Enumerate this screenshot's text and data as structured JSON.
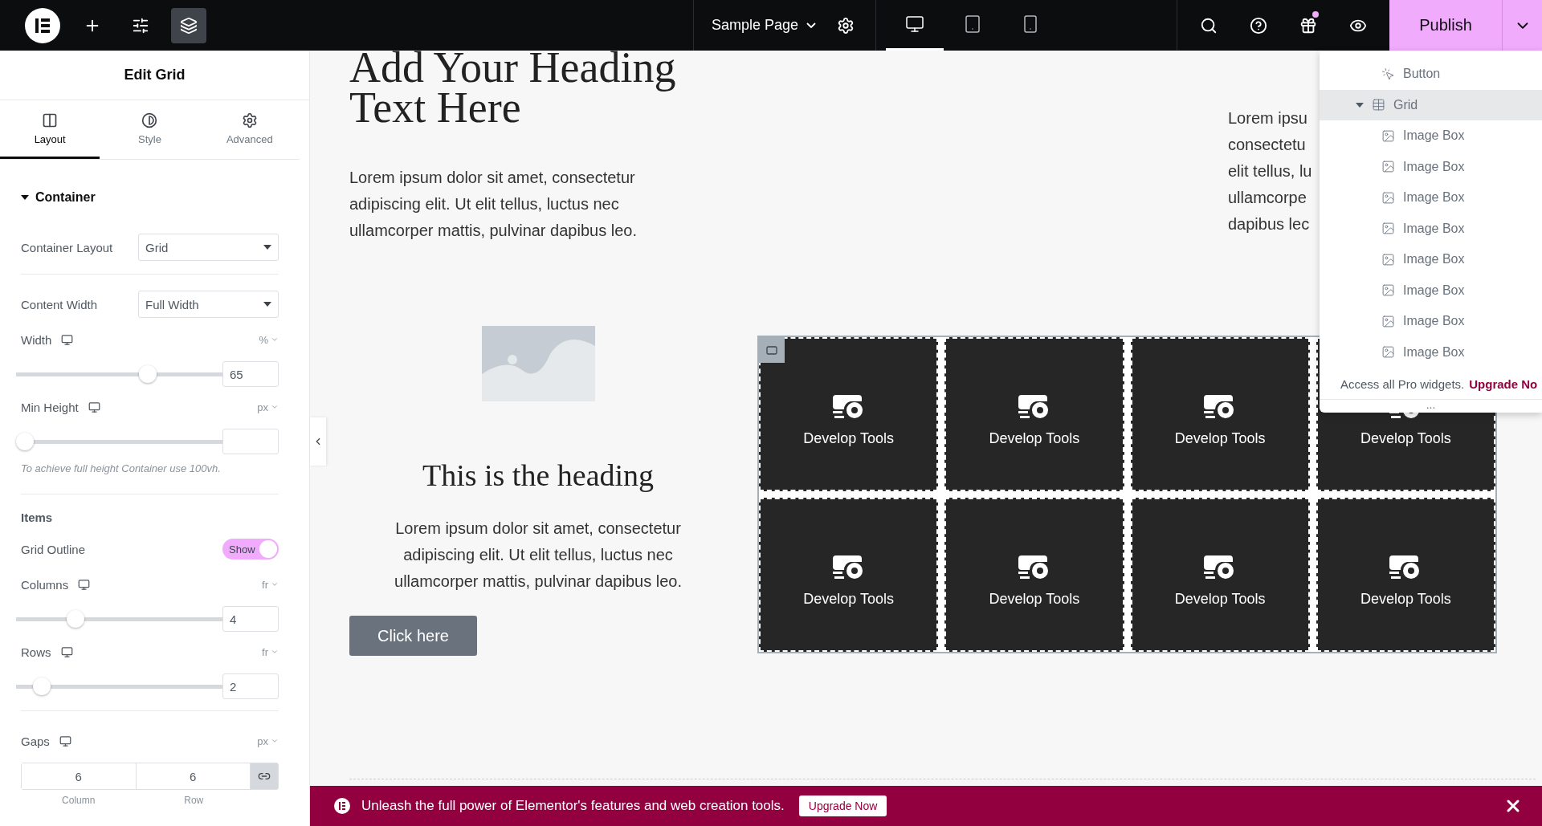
{
  "topbar": {
    "tools": [
      {
        "kind": "add",
        "selected": false
      },
      {
        "kind": "sliders",
        "selected": false
      },
      {
        "kind": "layers",
        "selected": true
      }
    ],
    "page_title": "Sample Page",
    "devices": [
      {
        "kind": "desktop",
        "selected": true
      },
      {
        "kind": "tablet",
        "selected": false
      },
      {
        "kind": "mobile",
        "selected": false
      }
    ],
    "right_tools": [
      {
        "kind": "search",
        "badge": false
      },
      {
        "kind": "help",
        "badge": false
      },
      {
        "kind": "gift",
        "badge": true
      },
      {
        "kind": "preview",
        "badge": false
      }
    ],
    "publish": "Publish"
  },
  "panel": {
    "title": "Edit Grid",
    "tabs": [
      {
        "kind": "layout",
        "label": "Layout",
        "selected": true
      },
      {
        "kind": "style",
        "label": "Style",
        "selected": false
      },
      {
        "kind": "advanced",
        "label": "Advanced",
        "selected": false
      }
    ],
    "section": {
      "title": "Container",
      "expanded": true
    },
    "controls": [
      {
        "kind": "select",
        "label": "Container Layout",
        "value": "Grid"
      },
      {
        "kind": "divider"
      },
      {
        "kind": "select",
        "label": "Content Width",
        "value": "Full Width"
      },
      {
        "kind": "slider",
        "label": "Width",
        "unit": "%",
        "level": 0.65,
        "value": "65"
      },
      {
        "kind": "slider",
        "label": "Min Height",
        "unit": "px",
        "level": 0
      },
      {
        "kind": "note",
        "text": "To achieve full height Container use 100vh."
      },
      {
        "kind": "divider"
      },
      {
        "kind": "heading",
        "text": "Items"
      },
      {
        "kind": "switch",
        "label": "Grid Outline",
        "on": true,
        "text": "Show"
      },
      {
        "kind": "slider",
        "label": "Columns",
        "unit": "fr",
        "level": 0.27,
        "value": "4"
      },
      {
        "kind": "slider",
        "label": "Rows",
        "unit": "fr",
        "level": 0.09,
        "value": "2"
      },
      {
        "kind": "divider"
      },
      {
        "kind": "gaps",
        "label": "Gaps",
        "unit": "px",
        "values": [
          "6",
          "6"
        ],
        "captions": [
          "Column",
          "Row"
        ],
        "linked": true
      }
    ]
  },
  "canvas": {
    "hero": {
      "heading": "Add Your Heading Text Here",
      "paragraph": "Lorem ipsum dolor sit amet, consectetur adipiscing elit. Ut elit tellus, luctus nec ullamcorper mattis, pulvinar dapibus leo."
    },
    "aside_lines": [
      "Lorem ipsu",
      "consectetu",
      "elit tellus, lu",
      "ullamcorpe",
      "dapibus lec"
    ],
    "feature": {
      "heading": "This is the heading",
      "paragraph": "Lorem ipsum dolor sit amet, consectetur adipiscing elit. Ut elit tellus, luctus nec ullamcorper mattis, pulvinar dapibus leo.",
      "button": "Click here"
    },
    "grid": {
      "cells": [
        {
          "title": "Develop Tools"
        },
        {
          "title": "Develop Tools"
        },
        {
          "title": "Develop Tools"
        },
        {
          "title": "Develop Tools"
        },
        {
          "title": "Develop Tools"
        },
        {
          "title": "Develop Tools"
        },
        {
          "title": "Develop Tools"
        },
        {
          "title": "Develop Tools"
        }
      ]
    }
  },
  "navigator": {
    "items": [
      {
        "kind": "button",
        "label": "Button",
        "selected": false
      },
      {
        "kind": "grid",
        "label": "Grid",
        "selected": true,
        "expanded": true,
        "children": [
          {
            "kind": "image-box",
            "label": "Image Box",
            "selected": false
          },
          {
            "kind": "image-box",
            "label": "Image Box",
            "selected": false
          },
          {
            "kind": "image-box",
            "label": "Image Box",
            "selected": false
          },
          {
            "kind": "image-box",
            "label": "Image Box",
            "selected": false
          },
          {
            "kind": "image-box",
            "label": "Image Box",
            "selected": false
          },
          {
            "kind": "image-box",
            "label": "Image Box",
            "selected": false
          },
          {
            "kind": "image-box",
            "label": "Image Box",
            "selected": false
          },
          {
            "kind": "image-box",
            "label": "Image Box",
            "selected": false
          }
        ]
      }
    ],
    "promo": "Access all Pro widgets.",
    "promo_link": "Upgrade No",
    "more": "..."
  },
  "banner": {
    "text": "Unleash the full power of Elementor's features and web creation tools.",
    "button": "Upgrade Now"
  }
}
